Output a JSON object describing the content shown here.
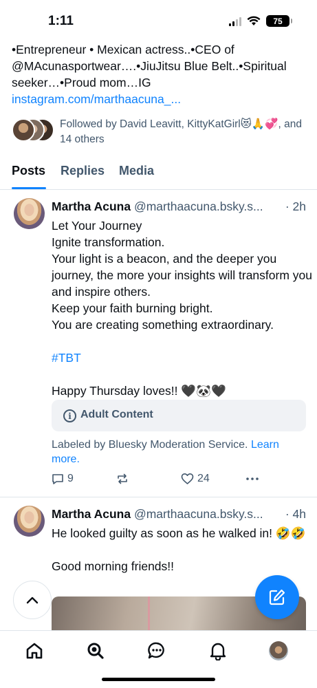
{
  "status_bar": {
    "time": "1:11",
    "battery": "75"
  },
  "bio": {
    "text": "•Entrepreneur • Mexican actress..•CEO of @MAcunasportwear….•JiuJitsu Blue Belt..•Spiritual seeker…•Proud mom…IG",
    "link": "instagram.com/marthaacuna_..."
  },
  "followers": {
    "text": "Followed by David Leavitt, KittyKatGirl😻🙏💞, and 14 others"
  },
  "tabs": [
    {
      "label": "Posts",
      "active": true
    },
    {
      "label": "Replies",
      "active": false
    },
    {
      "label": "Media",
      "active": false
    }
  ],
  "posts": [
    {
      "author": "Martha Acuna",
      "handle": "@marthaacuna.bsky.s...",
      "time": "· 2h",
      "lines": [
        "Let Your Journey",
        "Ignite transformation.",
        "Your light is a beacon, and the deeper you journey, the more your insights will transform you and inspire others.",
        "Keep your faith burning bright.",
        "You are creating something extraordinary.",
        "",
        "#TBT",
        "",
        "Happy Thursday loves!! 🖤🐼🖤"
      ],
      "content_warning": "Adult Content",
      "label_note": "Labeled by Bluesky Moderation Service.",
      "learn_more": "Learn more.",
      "replies": "9",
      "likes": "24"
    },
    {
      "author": "Martha Acuna",
      "handle": "@marthaacuna.bsky.s...",
      "time": "· 4h",
      "lines": [
        "He looked guilty as soon as he walked in! 🤣🤣",
        "",
        "Good morning friends!!"
      ]
    }
  ],
  "colors": {
    "accent": "#1083fe",
    "muted": "#42576c",
    "text": "#0b0f14"
  }
}
